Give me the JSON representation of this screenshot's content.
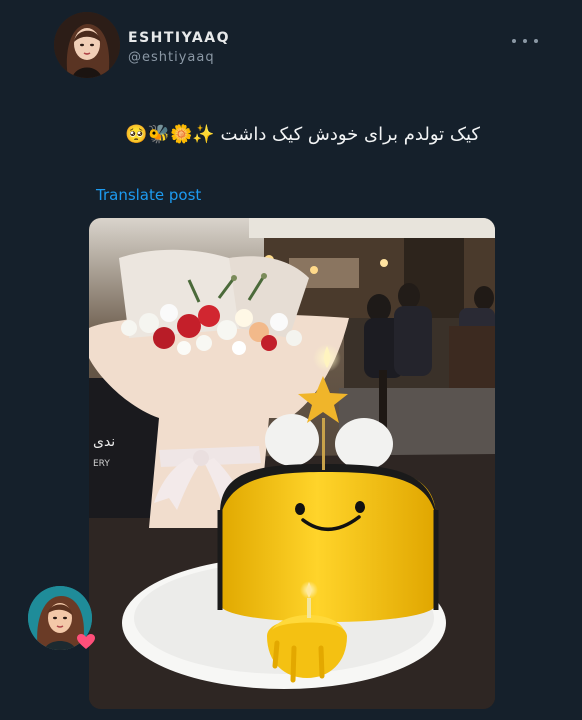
{
  "author": {
    "name": "ESHTIYAAQ",
    "handle": "@eshtiyaaq"
  },
  "icons": {
    "more": "more-horizontal-icon",
    "heart": "heart-icon"
  },
  "post": {
    "text": "کیک تولدم برای خودش کیک داشت ✨🌼🐝🥺",
    "translate_label": "Translate post"
  },
  "media": {
    "description": "",
    "bag_text": "ERY",
    "board_text": "ندى"
  },
  "colors": {
    "background": "#15202b",
    "link": "#1d9bf0",
    "secondary_text": "#8b98a5",
    "cake": "#f5c518"
  }
}
